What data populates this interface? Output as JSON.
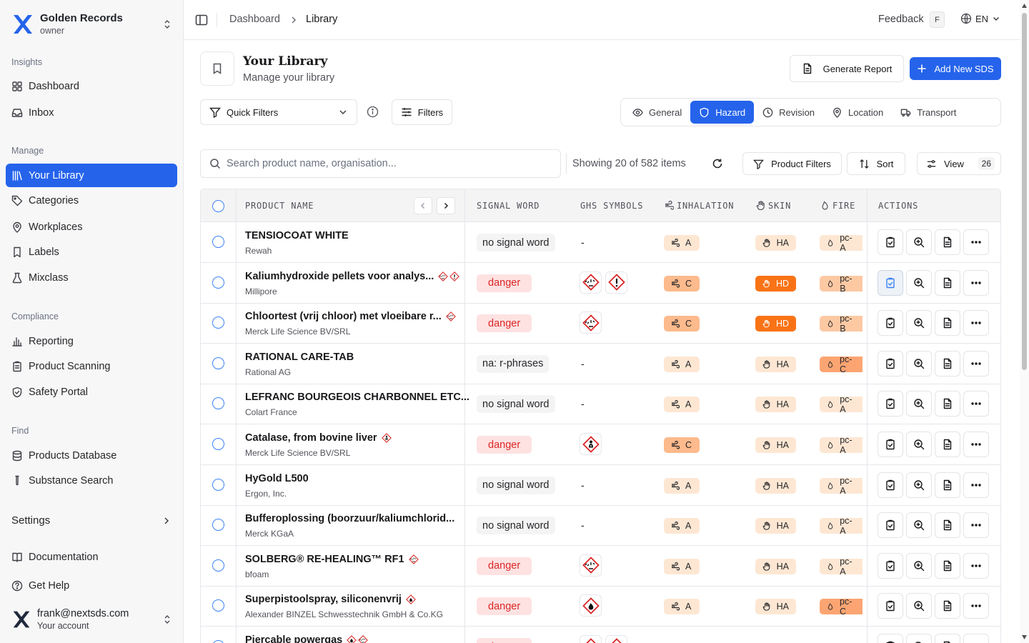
{
  "org": {
    "name": "Golden Records",
    "role": "owner"
  },
  "sidebar": {
    "sections": [
      {
        "title": "Insights",
        "items": [
          {
            "label": "Dashboard",
            "icon": "dashboard-icon"
          },
          {
            "label": "Inbox",
            "icon": "inbox-icon"
          }
        ]
      },
      {
        "title": "Manage",
        "items": [
          {
            "label": "Your Library",
            "icon": "library-icon",
            "active": true
          },
          {
            "label": "Categories",
            "icon": "tag-icon"
          },
          {
            "label": "Workplaces",
            "icon": "map-pin-icon"
          },
          {
            "label": "Labels",
            "icon": "bookmark-icon"
          },
          {
            "label": "Mixclass",
            "icon": "flask-icon"
          }
        ]
      },
      {
        "title": "Compliance",
        "items": [
          {
            "label": "Reporting",
            "icon": "bar-chart-icon"
          },
          {
            "label": "Product Scanning",
            "icon": "clipboard-icon"
          },
          {
            "label": "Safety Portal",
            "icon": "shield-check-icon"
          }
        ]
      },
      {
        "title": "Find",
        "items": [
          {
            "label": "Products Database",
            "icon": "database-icon"
          },
          {
            "label": "Substance Search",
            "icon": "test-tube-icon"
          }
        ]
      }
    ],
    "settings": "Settings",
    "documentation": "Documentation",
    "help": "Get Help"
  },
  "user": {
    "email": "frank@nextsds.com",
    "sub": "Your account"
  },
  "topbar": {
    "crumb1": "Dashboard",
    "crumb2": "Library",
    "feedback": "Feedback",
    "feedback_key": "F",
    "lang": "EN"
  },
  "header": {
    "title": "Your Library",
    "subtitle": "Manage your library",
    "report_btn": "Generate Report",
    "add_btn": "Add New SDS"
  },
  "filters": {
    "quick": "Quick Filters",
    "filters": "Filters"
  },
  "tabs": [
    {
      "label": "General",
      "icon": "eye-icon"
    },
    {
      "label": "Hazard",
      "icon": "shield-icon",
      "active": true
    },
    {
      "label": "Revision",
      "icon": "clock-icon"
    },
    {
      "label": "Location",
      "icon": "map-pin-icon"
    },
    {
      "label": "Transport",
      "icon": "truck-icon"
    }
  ],
  "search": {
    "placeholder": "Search product name, organisation..."
  },
  "showing": "Showing 20 of 582 items",
  "toolbar": {
    "product_filters": "Product Filters",
    "sort": "Sort",
    "view": "View",
    "view_count": "26"
  },
  "columns": {
    "product": "PRODUCT NAME",
    "signal": "SIGNAL WORD",
    "ghs": "GHS SYMBOLS",
    "inhalation": "INHALATION",
    "skin": "SKIN",
    "fire": "FIRE",
    "actions": "ACTIONS"
  },
  "rows": [
    {
      "name": "TENSIOCOAT WHITE",
      "company": "Rewah",
      "name_ghs": [],
      "signal": "no signal word",
      "ghs": [],
      "inhalation": "A",
      "skin": "HA",
      "fire": "pc-A"
    },
    {
      "name": "Kaliumhydroxide pellets voor analys...",
      "company": "Millipore",
      "name_ghs": [
        "corrosive-icon",
        "exclamation-icon"
      ],
      "signal": "danger",
      "ghs": [
        "corrosive-icon",
        "exclamation-icon"
      ],
      "inhalation": "C",
      "skin": "HD",
      "fire": "pc-B",
      "highlight": true
    },
    {
      "name": "Chloortest (vrij chloor) met vloeibare r...",
      "company": "Merck Life Science BV/SRL",
      "name_ghs": [
        "corrosive-icon"
      ],
      "signal": "danger",
      "ghs": [
        "corrosive-icon"
      ],
      "inhalation": "C",
      "skin": "HD",
      "fire": "pc-B"
    },
    {
      "name": "RATIONAL CARE-TAB",
      "company": "Rational AG",
      "name_ghs": [],
      "signal": "na: r-phrases",
      "ghs": [],
      "inhalation": "A",
      "skin": "HA",
      "fire": "pc-C"
    },
    {
      "name": "LEFRANC BOURGEOIS CHARBONNEL ETC...",
      "company": "Colart France",
      "name_ghs": [],
      "signal": "no signal word",
      "ghs": [],
      "inhalation": "A",
      "skin": "HA",
      "fire": "pc-A"
    },
    {
      "name": "Catalase, from bovine liver",
      "company": "Merck Life Science BV/SRL",
      "name_ghs": [
        "health-hazard-icon"
      ],
      "signal": "danger",
      "ghs": [
        "health-hazard-icon"
      ],
      "inhalation": "C",
      "skin": "HA",
      "fire": "pc-A"
    },
    {
      "name": "HyGold L500",
      "company": "Ergon, Inc.",
      "name_ghs": [],
      "signal": "no signal word",
      "ghs": [],
      "inhalation": "A",
      "skin": "HA",
      "fire": "pc-A"
    },
    {
      "name": "Bufferoplossing (boorzuur/kaliumchlorid...",
      "company": "Merck KGaA",
      "name_ghs": [],
      "signal": "no signal word",
      "ghs": [],
      "inhalation": "A",
      "skin": "HA",
      "fire": "pc-A"
    },
    {
      "name": "SOLBERG® RE-HEALING™ RF1",
      "company": "bfoam",
      "name_ghs": [
        "corrosive-icon"
      ],
      "signal": "danger",
      "ghs": [
        "corrosive-icon"
      ],
      "inhalation": "A",
      "skin": "HA",
      "fire": "pc-A"
    },
    {
      "name": "Superpistoolspray, siliconenvrij",
      "company": "Alexander BINZEL Schwesstechnik GmbH & Co.KG",
      "name_ghs": [
        "flame-icon"
      ],
      "signal": "danger",
      "ghs": [
        "flame-icon"
      ],
      "inhalation": "A",
      "skin": "HA",
      "fire": "pc-C"
    },
    {
      "name": "Piercable powergas",
      "company": "",
      "name_ghs": [
        "flame-icon",
        "corrosive-icon"
      ],
      "signal": "danger",
      "ghs": [
        "flame-icon",
        "corrosive-icon"
      ],
      "inhalation": "",
      "skin": "",
      "fire": ""
    }
  ],
  "colors": {
    "primary": "#2563eb",
    "danger_text": "#dc2626",
    "danger_bg": "#fee2e2"
  }
}
